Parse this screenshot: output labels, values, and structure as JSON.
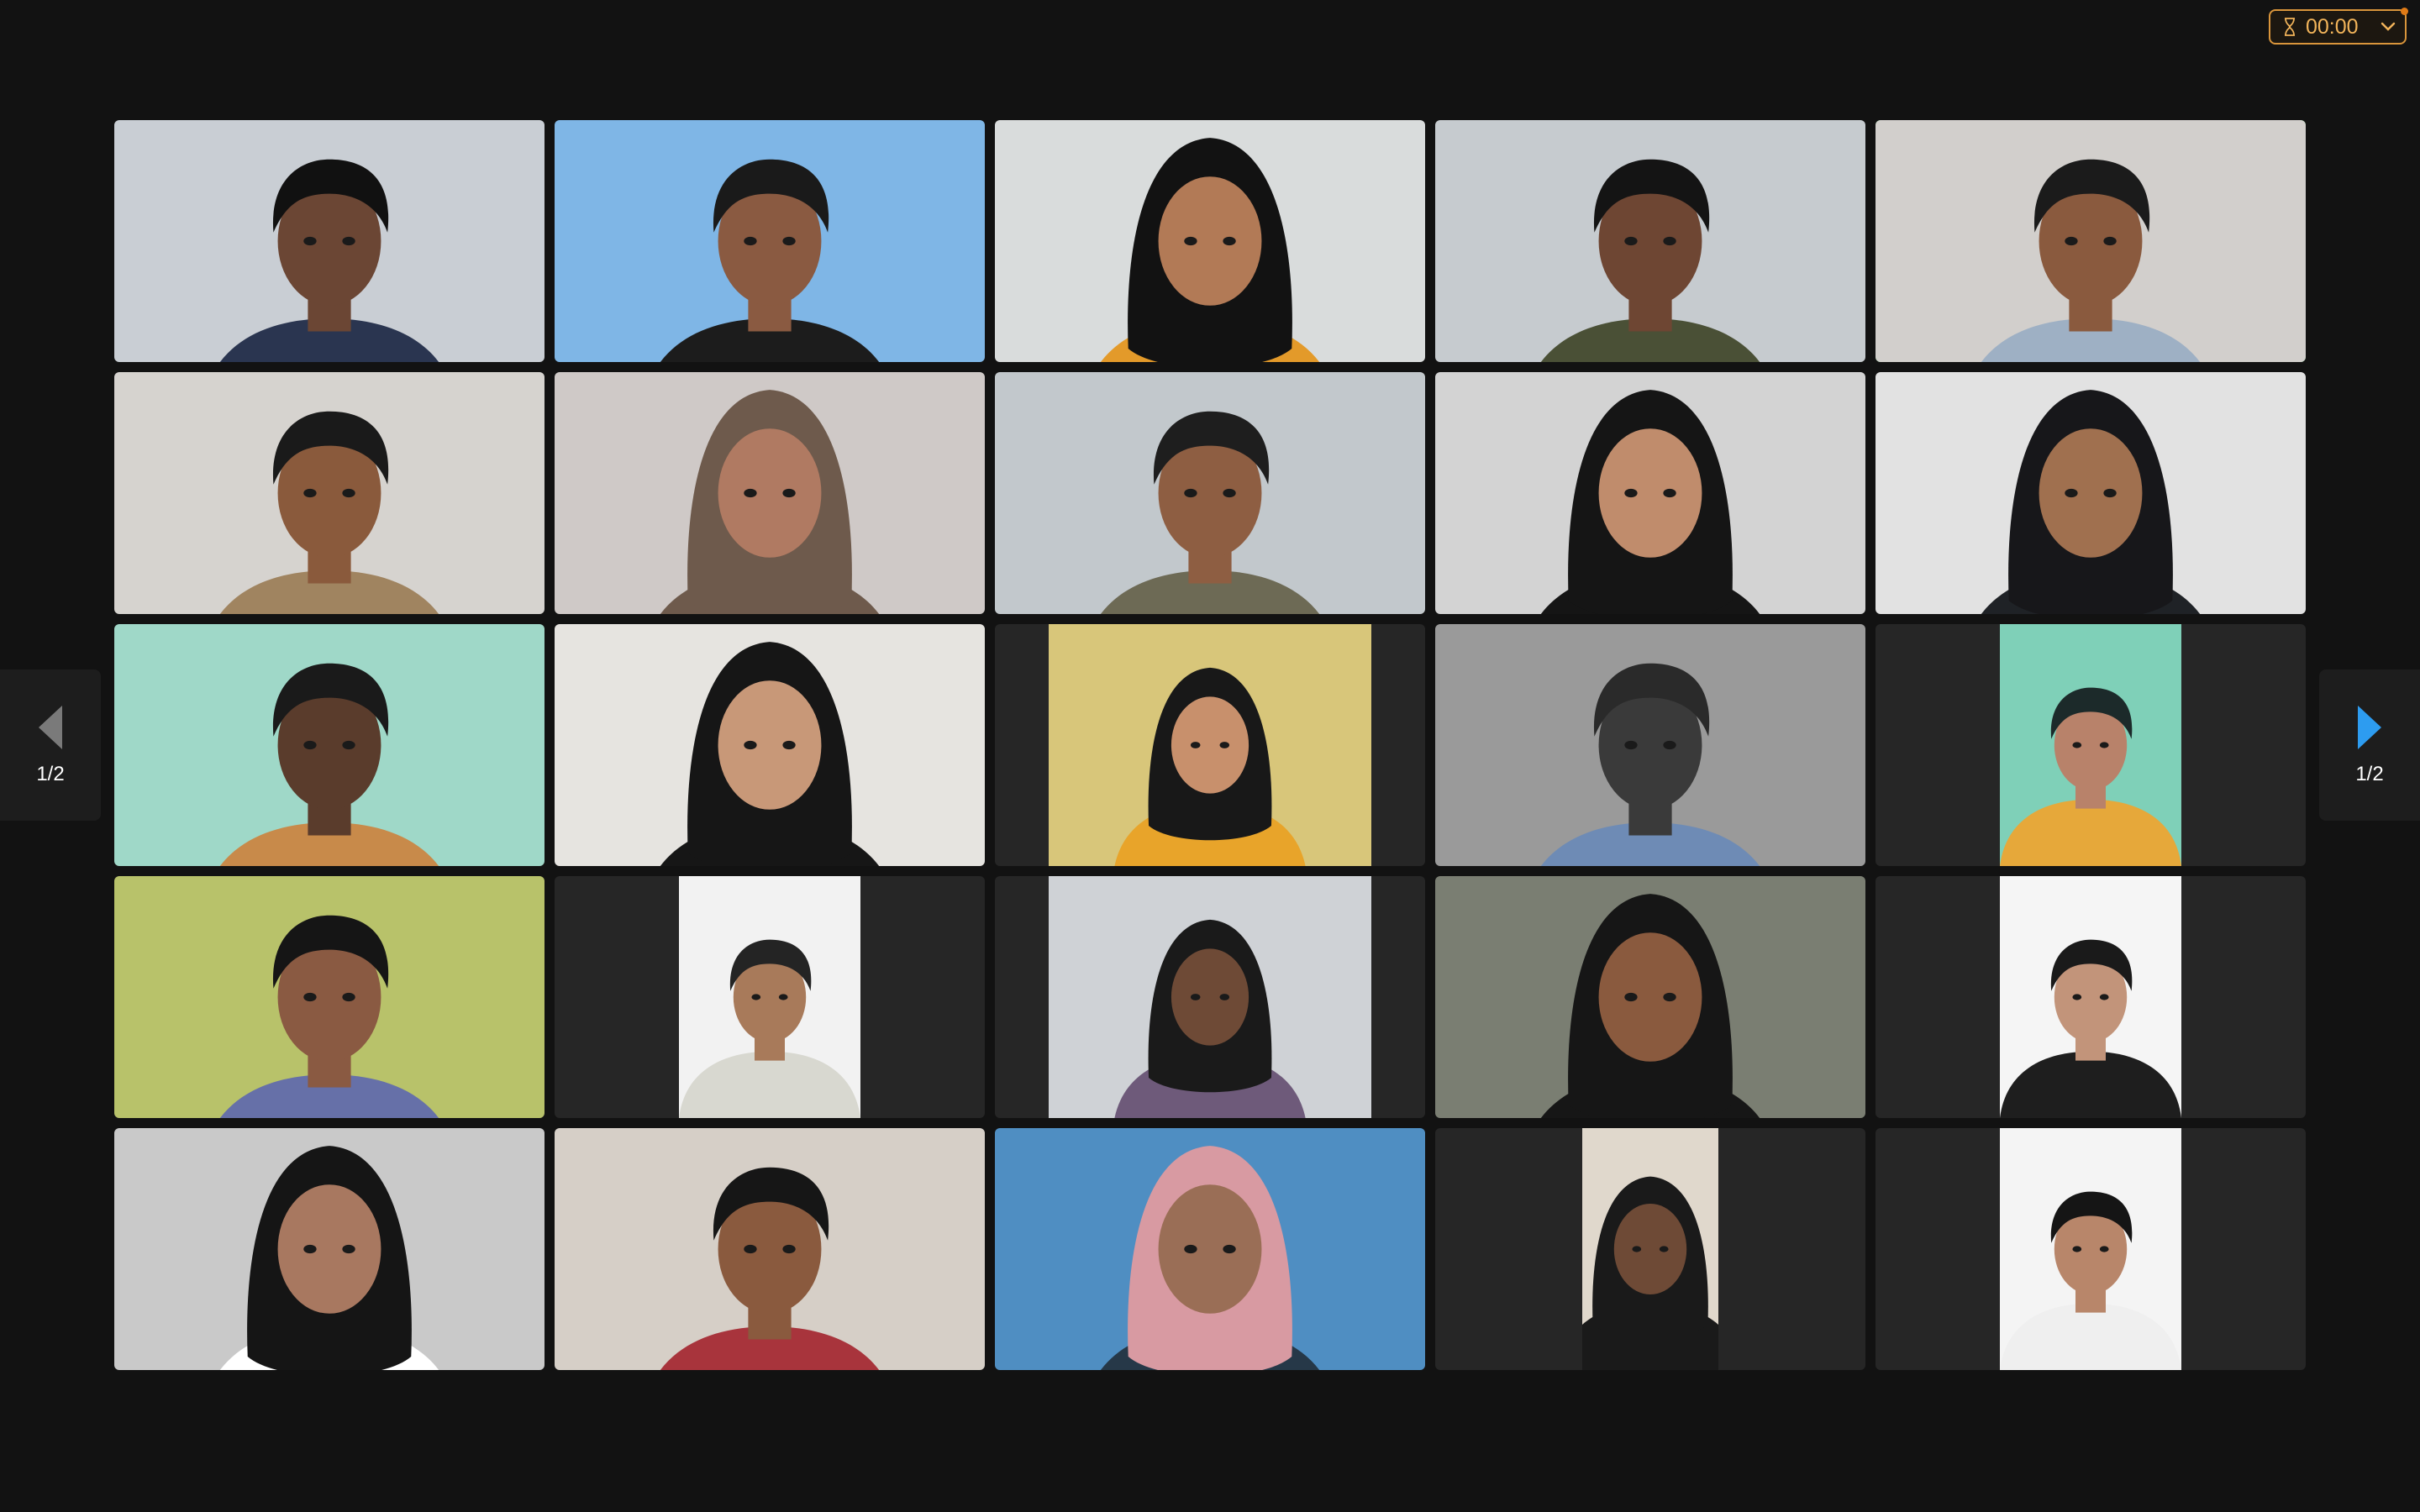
{
  "timer": {
    "value": "00:00",
    "icon": "hourglass-icon",
    "dropdown_icon": "chevron-down-icon",
    "accent": "#d9953b"
  },
  "gallery": {
    "page_indicator_prev": "1/2",
    "page_indicator_next": "1/2",
    "active_speaker_color": "#2fd44e",
    "tiles": [
      {
        "bg": "#c9ced4",
        "skin": "#6b4634",
        "hair": "#111111",
        "shirt": "#2a3550",
        "hijab": false,
        "layout": "full"
      },
      {
        "bg": "#7fb6e6",
        "skin": "#8a5a41",
        "hair": "#1a1a1a",
        "shirt": "#1c1c1c",
        "hijab": false,
        "layout": "full"
      },
      {
        "bg": "#d9dcdc",
        "skin": "#b27a56",
        "hair": "#121212",
        "shirt": "#e39a2a",
        "hijab": true,
        "layout": "full"
      },
      {
        "bg": "#c6cbcf",
        "skin": "#6e4633",
        "hair": "#141414",
        "shirt": "#4a5036",
        "hijab": false,
        "layout": "full"
      },
      {
        "bg": "#d2cfcc",
        "skin": "#8a5a3e",
        "hair": "#1b1b1b",
        "shirt": "#9eb0c4",
        "hijab": false,
        "layout": "full"
      },
      {
        "bg": "#d6d3cf",
        "skin": "#8a5a3c",
        "hair": "#1a1a1a",
        "shirt": "#a08460",
        "hijab": false,
        "layout": "full"
      },
      {
        "bg": "#cfc9c7",
        "skin": "#b07a62",
        "hair": "#6e5a4c",
        "shirt": "#6e5a4c",
        "hijab": true,
        "layout": "full"
      },
      {
        "bg": "#c2c8cc",
        "skin": "#8e5e42",
        "hair": "#1e1e1e",
        "shirt": "#6d6a55",
        "hijab": false,
        "layout": "full"
      },
      {
        "bg": "#d3d3d3",
        "skin": "#c08c6c",
        "hair": "#151515",
        "shirt": "#151515",
        "hijab": true,
        "layout": "full"
      },
      {
        "bg": "#e2e2e2",
        "skin": "#a0704f",
        "hair": "#17171a",
        "shirt": "#1f2226",
        "hijab": true,
        "layout": "full"
      },
      {
        "bg": "#9fd8c8",
        "skin": "#5a3c2c",
        "hair": "#1a1a1a",
        "shirt": "#c88a4a",
        "hijab": false,
        "layout": "full"
      },
      {
        "bg": "#e6e4e0",
        "skin": "#c89878",
        "hair": "#161616",
        "shirt": "#161616",
        "hijab": true,
        "layout": "full"
      },
      {
        "bg": "#d8c67a",
        "skin": "#c8906c",
        "hair": "#181818",
        "shirt": "#e8a42a",
        "hijab": true,
        "layout": "mid"
      },
      {
        "bg": "#9a9a9a",
        "skin": "#3a3a3a",
        "hair": "#2a2a2a",
        "shirt": "#6e8bb5",
        "hijab": false,
        "layout": "full"
      },
      {
        "bg": "#7fd0b8",
        "skin": "#b8826a",
        "hair": "#1c2a2a",
        "shirt": "#e6a83a",
        "hijab": false,
        "layout": "narrow"
      },
      {
        "bg": "#b8c26a",
        "skin": "#8a5a42",
        "hair": "#151515",
        "shirt": "#6670a8",
        "hijab": false,
        "layout": "full"
      },
      {
        "bg": "#f2f2f2",
        "skin": "#a87a5a",
        "hair": "#242424",
        "shirt": "#d8d8d0",
        "hijab": false,
        "layout": "narrow"
      },
      {
        "bg": "#cfd2d6",
        "skin": "#6e4a36",
        "hair": "#1a1a1a",
        "shirt": "#6e5a7a",
        "hijab": true,
        "layout": "mid"
      },
      {
        "bg": "#7a7e72",
        "skin": "#8a5a3e",
        "hair": "#161616",
        "shirt": "#161616",
        "hijab": true,
        "layout": "full"
      },
      {
        "bg": "#f5f5f5",
        "skin": "#c2947a",
        "hair": "#1a1a1a",
        "shirt": "#1e1e1e",
        "hijab": false,
        "layout": "narrow"
      },
      {
        "bg": "#c9c9c9",
        "skin": "#a87860",
        "hair": "#151515",
        "shirt": "#ffffff",
        "hijab": true,
        "layout": "full"
      },
      {
        "bg": "#d6cfc7",
        "skin": "#8a5a3e",
        "hair": "#161616",
        "shirt": "#a8343c",
        "hijab": false,
        "layout": "full"
      },
      {
        "bg": "#4f8ec2",
        "skin": "#9a6e56",
        "hair": "#d89aa2",
        "shirt": "#263848",
        "hijab": true,
        "layout": "full"
      },
      {
        "bg": "#e0d8cc",
        "skin": "#6e4a36",
        "hair": "#1a1a1a",
        "shirt": "#1a1a1a",
        "hijab": true,
        "layout": "small"
      },
      {
        "bg": "#f4f4f4",
        "skin": "#b8866a",
        "hair": "#151515",
        "shirt": "#efefef",
        "hijab": false,
        "layout": "narrow"
      }
    ]
  }
}
